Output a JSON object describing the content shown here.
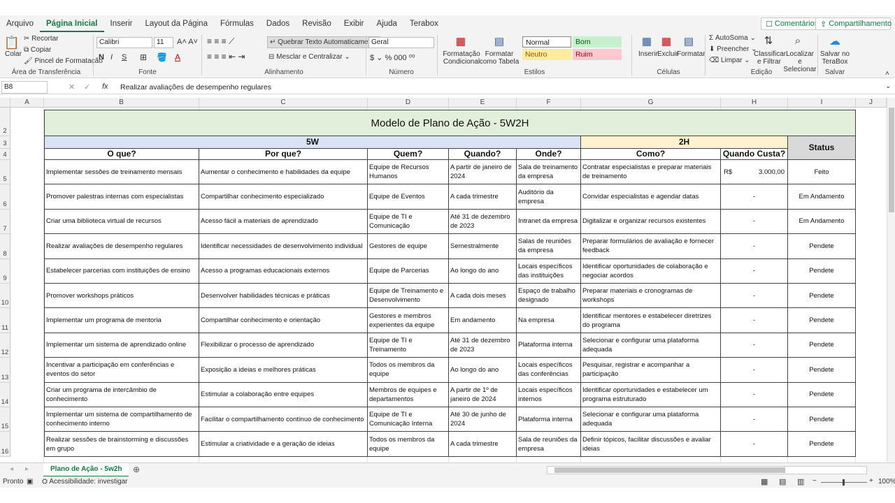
{
  "menu": [
    "Arquivo",
    "Página Inicial",
    "Inserir",
    "Layout da Página",
    "Fórmulas",
    "Dados",
    "Revisão",
    "Exibir",
    "Ajuda",
    "Terabox"
  ],
  "menu_active": "Página Inicial",
  "comments_label": "Comentários",
  "share_label": "Compartilhamento",
  "ribbon": {
    "clipboard": {
      "paste": "Colar",
      "cut": "Recortar",
      "copy": "Copiar",
      "format_painter": "Pincel de Formatação",
      "label": "Área de Transferência"
    },
    "font": {
      "name": "Calibri",
      "size": "11",
      "bold": "N",
      "italic": "I",
      "underline": "S",
      "label": "Fonte"
    },
    "alignment": {
      "wrap": "Quebrar Texto Automaticamente",
      "merge": "Mesclar e Centralizar",
      "label": "Alinhamento"
    },
    "number": {
      "format": "Geral",
      "label": "Número"
    },
    "styles": {
      "cond": "Formatação Condicional",
      "table": "Formatar como Tabela",
      "normal": "Normal",
      "bom": "Bom",
      "neutro": "Neutro",
      "ruim": "Ruim",
      "label": "Estilos"
    },
    "cells": {
      "insert": "Inserir",
      "delete": "Excluir",
      "format": "Formatar",
      "label": "Células"
    },
    "edit": {
      "autosum": "AutoSoma",
      "fill": "Preencher",
      "clear": "Limpar",
      "sort": "Classificar e Filtrar",
      "find": "Localizar e Selecionar",
      "label": "Edição"
    },
    "save": {
      "btn": "Salvar no TeraBox",
      "label": "Salvar"
    }
  },
  "formula_bar": {
    "cell_ref": "B8",
    "content": "Realizar avaliações de desempenho regulares"
  },
  "columns": [
    "A",
    "B",
    "C",
    "D",
    "E",
    "F",
    "G",
    "H",
    "I",
    "J"
  ],
  "sheet": {
    "title": "Modelo de Plano de Ação - 5W2H",
    "group_5w": "5W",
    "group_2h": "2H",
    "headers": [
      "O que?",
      "Por que?",
      "Quem?",
      "Quando?",
      "Onde?",
      "Como?",
      "Quando Custa?",
      "Status"
    ],
    "rows": [
      {
        "n": "5",
        "o": "Implementar sessões de treinamento mensais",
        "p": "Aumentar o conhecimento e habilidades da equipe",
        "q": "Equipe de Recursos Humanos",
        "w": "A partir de janeiro de 2024",
        "d": "Sala de treinamento da empresa",
        "c": "Contratar especialistas e preparar materiais de treinamento",
        "cur": "R$",
        "cost": "3.000,00",
        "s": "Feito"
      },
      {
        "n": "6",
        "o": "Promover palestras internas com especialistas",
        "p": "Compartilhar conhecimento especializado",
        "q": "Equipe de Eventos",
        "w": "A cada trimestre",
        "d": "Auditório da empresa",
        "c": "Convidar especialistas e agendar datas",
        "cur": "",
        "cost": "-",
        "s": "Em Andamento"
      },
      {
        "n": "7",
        "o": "Criar uma biblioteca virtual de recursos",
        "p": "Acesso fácil a materiais de aprendizado",
        "q": "Equipe de TI e Comunicação",
        "w": "Até 31 de dezembro de 2023",
        "d": "Intranet da empresa",
        "c": "Digitalizar e organizar recursos existentes",
        "cur": "",
        "cost": "-",
        "s": "Em Andamento"
      },
      {
        "n": "8",
        "o": "Realizar avaliações de desempenho regulares",
        "p": "Identificar necessidades de desenvolvimento individual",
        "q": "Gestores de equipe",
        "w": "Semestralmente",
        "d": "Salas de reuniões da empresa",
        "c": "Preparar formulários de avaliação e fornecer feedback",
        "cur": "",
        "cost": "-",
        "s": "Pendete"
      },
      {
        "n": "9",
        "o": "Estabelecer parcerias com instituições de ensino",
        "p": "Acesso a programas educacionais externos",
        "q": "Equipe de Parcerias",
        "w": "Ao longo do ano",
        "d": "Locais específicos das instituições",
        "c": "Identificar oportunidades de colaboração e negociar acordos",
        "cur": "",
        "cost": "-",
        "s": "Pendete"
      },
      {
        "n": "10",
        "o": "Promover workshops práticos",
        "p": "Desenvolver habilidades técnicas e práticas",
        "q": "Equipe de Treinamento e Desenvolvimento",
        "w": "A cada dois meses",
        "d": "Espaço de trabalho designado",
        "c": "Preparar materiais e cronogramas de workshops",
        "cur": "",
        "cost": "-",
        "s": "Pendete"
      },
      {
        "n": "11",
        "o": "Implementar um programa de mentoria",
        "p": "Compartilhar conhecimento e orientação",
        "q": "Gestores e membros experientes da equipe",
        "w": "Em andamento",
        "d": "Na empresa",
        "c": "Identificar mentores e estabelecer diretrizes do programa",
        "cur": "",
        "cost": "-",
        "s": "Pendete"
      },
      {
        "n": "12",
        "o": "Implementar um sistema de aprendizado online",
        "p": "Flexibilizar o processo de aprendizado",
        "q": "Equipe de TI e Treinamento",
        "w": "Até 31 de dezembro de 2023",
        "d": "Plataforma interna",
        "c": "Selecionar e configurar uma plataforma adequada",
        "cur": "",
        "cost": "-",
        "s": "Pendete"
      },
      {
        "n": "13",
        "o": "Incentivar a participação em conferências e eventos do setor",
        "p": "Exposição a ideias e melhores práticas",
        "q": "Todos os membros da equipe",
        "w": "Ao longo do ano",
        "d": "Locais específicos das conferências",
        "c": "Pesquisar, registrar e acompanhar a participação",
        "cur": "",
        "cost": "-",
        "s": "Pendete"
      },
      {
        "n": "14",
        "o": "Criar um programa de intercâmbio de conhecimento",
        "p": "Estimular a colaboração entre equipes",
        "q": "Membros de equipes e departamentos",
        "w": "A partir de 1º de janeiro de 2024",
        "d": "Locais específicos internos",
        "c": "Identificar oportunidades e estabelecer um programa estruturado",
        "cur": "",
        "cost": "-",
        "s": "Pendete"
      },
      {
        "n": "15",
        "o": "Implementar um sistema de compartilhamento de conhecimento interno",
        "p": "Facilitar o compartilhamento contínuo de conhecimento",
        "q": "Equipe de TI e Comunicação Interna",
        "w": "Até 30 de junho de 2024",
        "d": "Plataforma interna",
        "c": "Selecionar e configurar uma plataforma adequada",
        "cur": "",
        "cost": "-",
        "s": "Pendete"
      },
      {
        "n": "16",
        "o": "Realizar sessões de brainstorming e discussões em grupo",
        "p": "Estimular a criatividade e a geração de ideias",
        "q": "Todos os membros da equipe",
        "w": "A cada trimestre",
        "d": "Sala de reuniões da empresa",
        "c": "Definir tópicos, facilitar discussões e avaliar ideias",
        "cur": "",
        "cost": "-",
        "s": "Pendete"
      }
    ]
  },
  "sheet_tab": "Plano de Ação - 5w2h",
  "status": {
    "ready": "Pronto",
    "accessibility": "Acessibilidade: investigar",
    "zoom": "100%"
  },
  "colors": {
    "accent": "#107c41",
    "title_bg": "#e2efda",
    "fivew_bg": "#dae3f3",
    "twoh_bg": "#fff2cc",
    "status_bg": "#d9d9d9"
  }
}
